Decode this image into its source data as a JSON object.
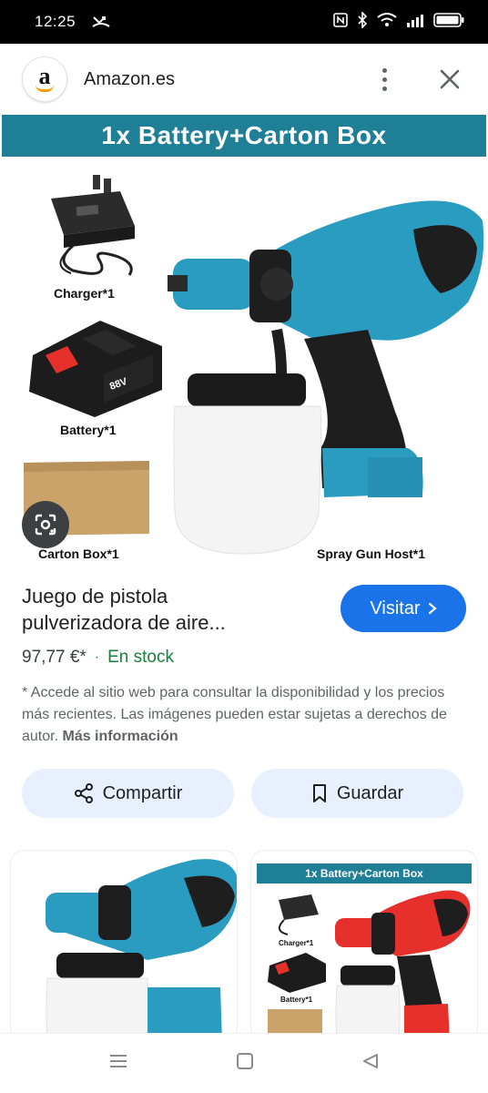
{
  "status_bar": {
    "time": "12:25"
  },
  "header": {
    "site_logo_letter": "a",
    "site_name": "Amazon.es",
    "more_icon": "more-vert-icon",
    "close_icon": "close-icon"
  },
  "image": {
    "banner": "1x Battery+Carton Box",
    "labels": {
      "charger": "Charger*1",
      "battery": "Battery*1",
      "carton": "Carton Box*1",
      "spray_gun": "Spray Gun Host*1",
      "battery_voltage": "88V"
    }
  },
  "product": {
    "title_line1": "Juego de pistola",
    "title_line2": "pulverizadora de aire...",
    "price": "97,77 €*",
    "separator": "·",
    "stock": "En stock",
    "visit_label": "Visitar"
  },
  "disclaimer": {
    "text": "* Accede al sitio web para consultar la disponibilidad y los precios más recientes. Las imágenes pueden estar sujetas a derechos de autor.",
    "more_info": "Más información"
  },
  "actions": {
    "share_label": "Compartir",
    "save_label": "Guardar"
  },
  "related": {
    "thumb2_banner": "1x Battery+Carton Box",
    "thumb2_label_charger": "Charger*1",
    "thumb2_label_battery": "Battery*1"
  },
  "colors": {
    "accent": "#1a73e8",
    "stock": "#188038",
    "banner": "#1f7f96",
    "tool_teal": "#2a9cc0",
    "tool_red": "#e5302b"
  }
}
